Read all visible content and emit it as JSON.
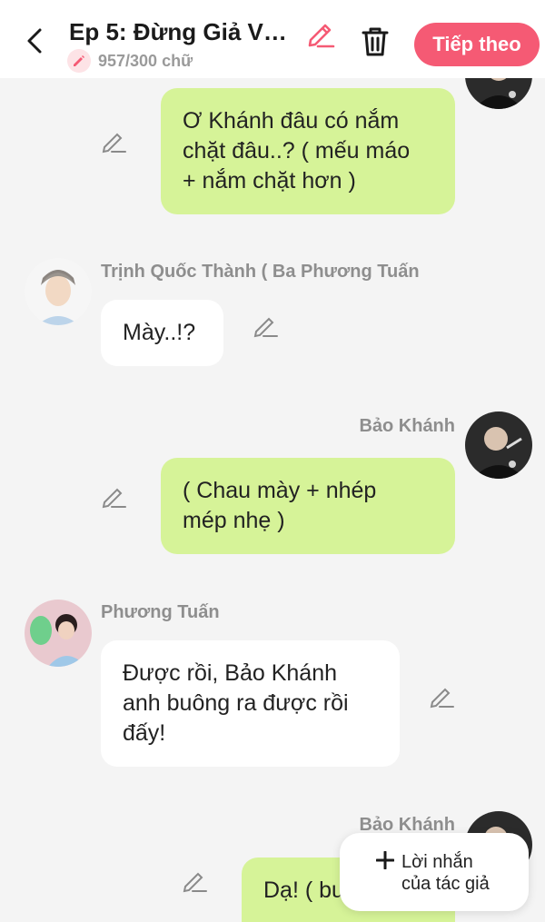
{
  "header": {
    "title": "Ep 5: Đừng Giả Vờ ...",
    "word_count": "957/300 chữ",
    "next_label": "Tiếp theo"
  },
  "messages": [
    {
      "side": "right",
      "name": "",
      "lines": [
        "Ơ Khánh đâu có nắm",
        "chặt đâu..? ( mếu máo",
        "+ nắm chặt hơn )"
      ]
    },
    {
      "side": "left",
      "name": "Trịnh Quốc Thành ( Ba Phương Tuấn",
      "lines": [
        "Mày..!?"
      ]
    },
    {
      "side": "right",
      "name": "Bảo Khánh",
      "lines": [
        "( Chau mày + nhép",
        "mép nhẹ )"
      ]
    },
    {
      "side": "left",
      "name": "Phương Tuấn",
      "lines": [
        "Được rồi, Bảo Khánh",
        "anh buông ra được rồi",
        "đấy!"
      ]
    },
    {
      "side": "right",
      "name": "Bảo Khánh",
      "lines": [
        "Dạ! ( bu"
      ]
    }
  ],
  "author_note": {
    "line1": "Lời nhắn",
    "line2": "của tác giả"
  },
  "colors": {
    "accent": "#f55a74",
    "bubble_green": "#d6f398",
    "background": "#f4f4f4"
  }
}
